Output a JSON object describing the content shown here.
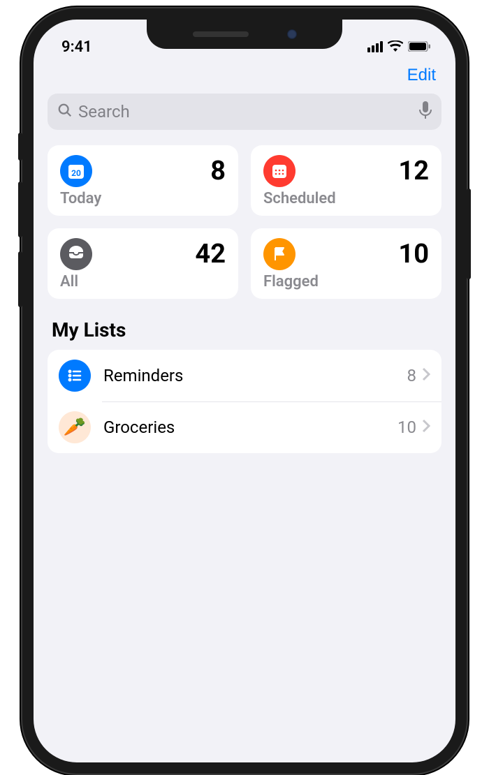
{
  "status": {
    "time": "9:41"
  },
  "nav": {
    "edit": "Edit"
  },
  "search": {
    "placeholder": "Search"
  },
  "cards": [
    {
      "label": "Today",
      "count": "8",
      "color": "blue",
      "icon": "calendar-today"
    },
    {
      "label": "Scheduled",
      "count": "12",
      "color": "red",
      "icon": "calendar"
    },
    {
      "label": "All",
      "count": "42",
      "color": "grey",
      "icon": "tray"
    },
    {
      "label": "Flagged",
      "count": "10",
      "color": "orange",
      "icon": "flag"
    }
  ],
  "section_header": "My Lists",
  "lists": [
    {
      "name": "Reminders",
      "count": "8",
      "icon": "list",
      "color": "blue"
    },
    {
      "name": "Groceries",
      "count": "10",
      "icon": "carrot",
      "color": "carrot"
    }
  ]
}
